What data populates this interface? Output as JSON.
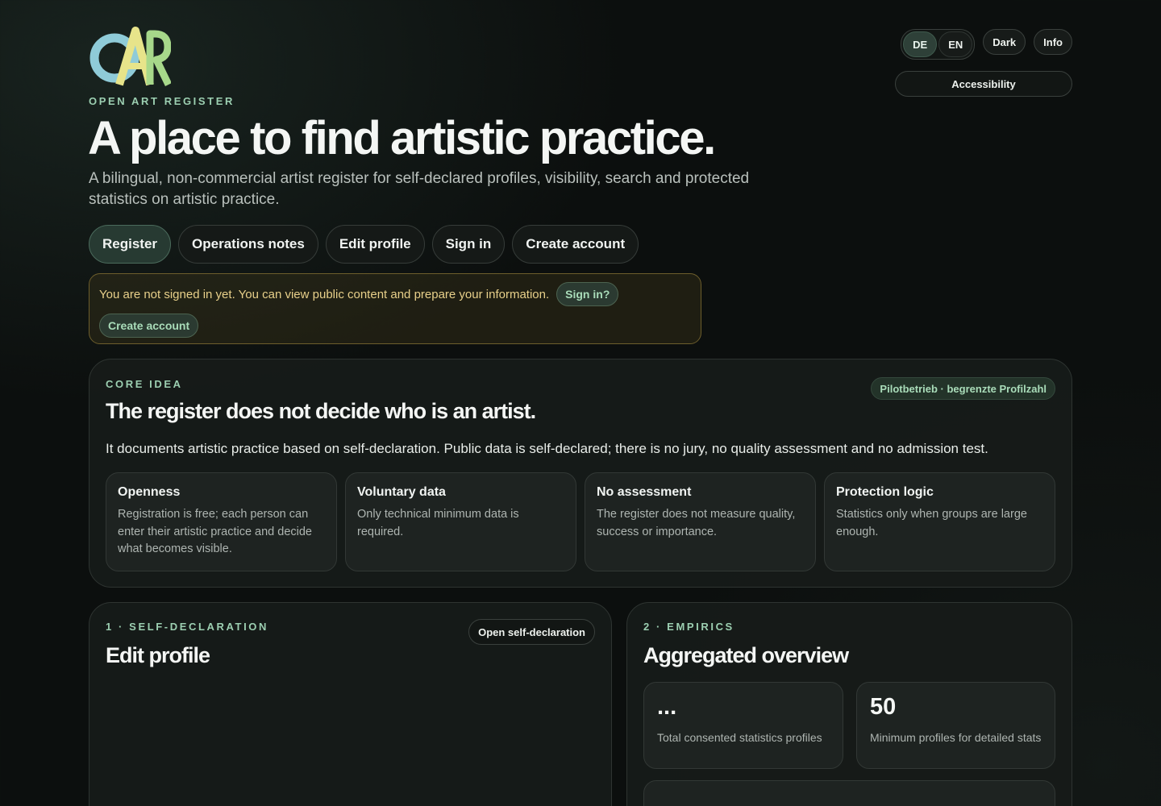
{
  "brand": {
    "logo_letters": "OAR",
    "name": "OPEN ART REGISTER"
  },
  "header": {
    "headline": "A place to find artistic practice.",
    "lead": "A bilingual, non-commercial artist register for self-declared profiles, visibility, search and protected statistics on artistic practice."
  },
  "controls": {
    "lang_de": "DE",
    "lang_en": "EN",
    "active_language": "DE",
    "theme": "Dark",
    "info": "Info",
    "accessibility": "Accessibility"
  },
  "nav": {
    "register": "Register",
    "operations_notes": "Operations notes",
    "edit_profile": "Edit profile",
    "sign_in": "Sign in",
    "create_account": "Create account",
    "active": "Register"
  },
  "notice": {
    "text": "You are not signed in yet. You can view public content and prepare your information.",
    "sign_in": "Sign in?",
    "create_account": "Create account"
  },
  "core": {
    "eyebrow": "CORE IDEA",
    "badge": "Pilotbetrieb · begrenzte Profilzahl",
    "title": "The register does not decide who is an artist.",
    "description": "It documents artistic practice based on self-declaration. Public data is self-declared; there is no jury, no quality assessment and no admission test.",
    "principles": [
      {
        "title": "Openness",
        "text": "Registration is free; each person can enter their artistic practice and decide what becomes visible."
      },
      {
        "title": "Voluntary data",
        "text": "Only technical minimum data is required."
      },
      {
        "title": "No assessment",
        "text": "The register does not measure quality, success or importance."
      },
      {
        "title": "Protection logic",
        "text": "Statistics only when groups are large enough."
      }
    ]
  },
  "self_declaration": {
    "eyebrow": "1 · SELF-DECLARATION",
    "title": "Edit profile",
    "open_button": "Open self-declaration"
  },
  "empirics": {
    "eyebrow": "2 · EMPIRICS",
    "title": "Aggregated overview",
    "stats": [
      {
        "value": "...",
        "label": "Total consented statistics profiles"
      },
      {
        "value": "50",
        "label": "Minimum profiles for detailed stats"
      }
    ]
  },
  "colors": {
    "accent": "#9ccfb1",
    "logo_blue": "#8fcbd8",
    "logo_yellow": "#e7e48a",
    "logo_green": "#a7d88a",
    "notice_border": "#6d5e2c",
    "notice_text": "#e8d08a"
  }
}
